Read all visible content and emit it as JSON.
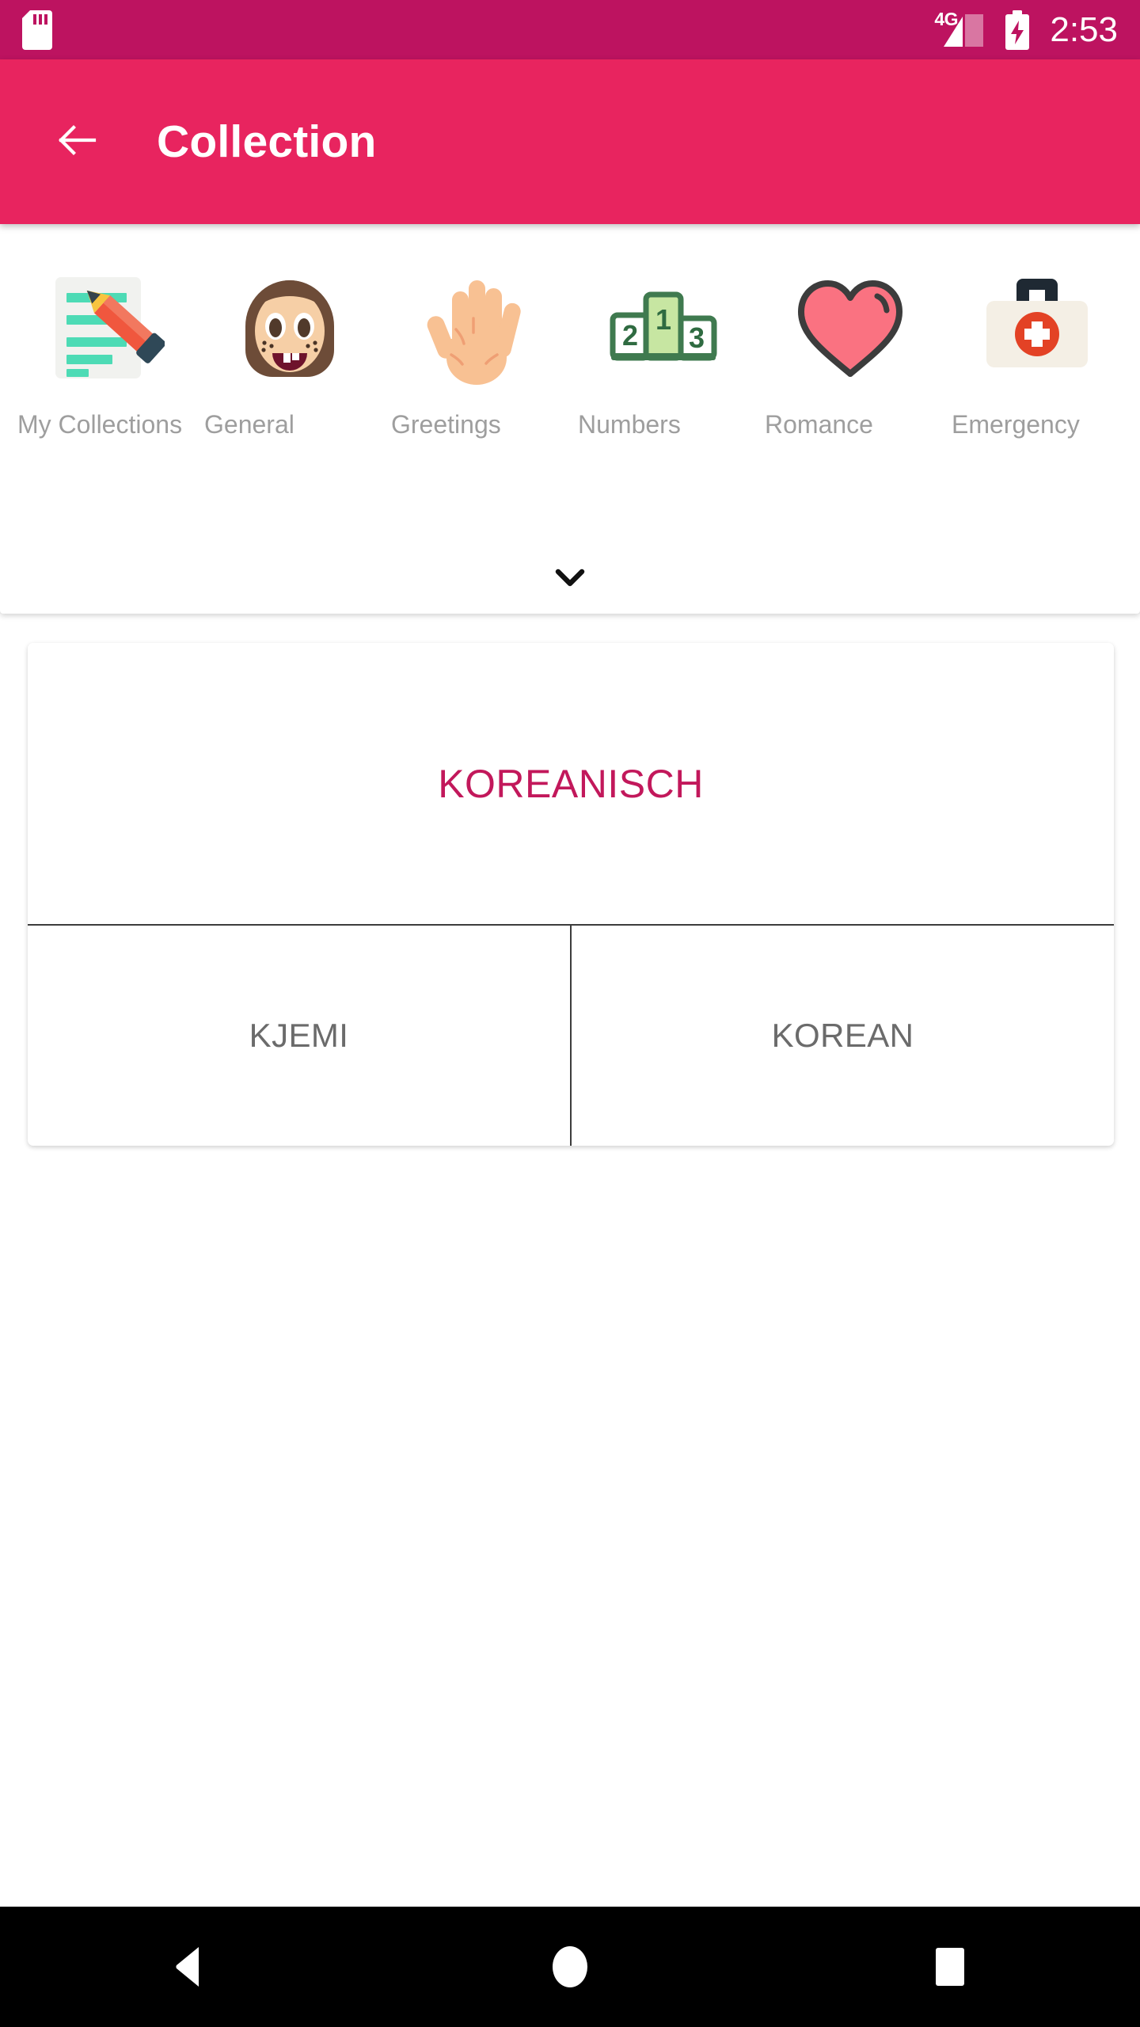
{
  "status_bar": {
    "sd_card_icon": "sd-card-icon",
    "network_label": "4G",
    "signal_icon": "signal-bars-icon",
    "battery_icon": "battery-charging-icon",
    "time": "2:53",
    "background_color": "#bd1360"
  },
  "app_bar": {
    "back_icon": "arrow-left-icon",
    "title": "Collection",
    "background_color": "#e8245f",
    "text_color": "#ffffff"
  },
  "categories": {
    "items": [
      {
        "label": "My Collections",
        "icon": "memo-pencil-emoji"
      },
      {
        "label": "General",
        "icon": "girl-face-emoji"
      },
      {
        "label": "Greetings",
        "icon": "raised-hand-emoji"
      },
      {
        "label": "Numbers",
        "icon": "podium-123-emoji"
      },
      {
        "label": "Romance",
        "icon": "heart-emoji"
      },
      {
        "label": "Emergency",
        "icon": "first-aid-kit-emoji"
      }
    ],
    "expand_icon": "chevron-down-icon",
    "label_color": "#9e9e9e"
  },
  "card": {
    "headline": "KOREANISCH",
    "headline_color": "#c2185b",
    "options": [
      {
        "label": "KJEMI"
      },
      {
        "label": "KOREAN"
      }
    ],
    "option_color": "#6b6b6b"
  },
  "nav_bar": {
    "back": "triangle-back-icon",
    "home": "circle-home-icon",
    "recents": "square-recents-icon",
    "background_color": "#000000"
  }
}
